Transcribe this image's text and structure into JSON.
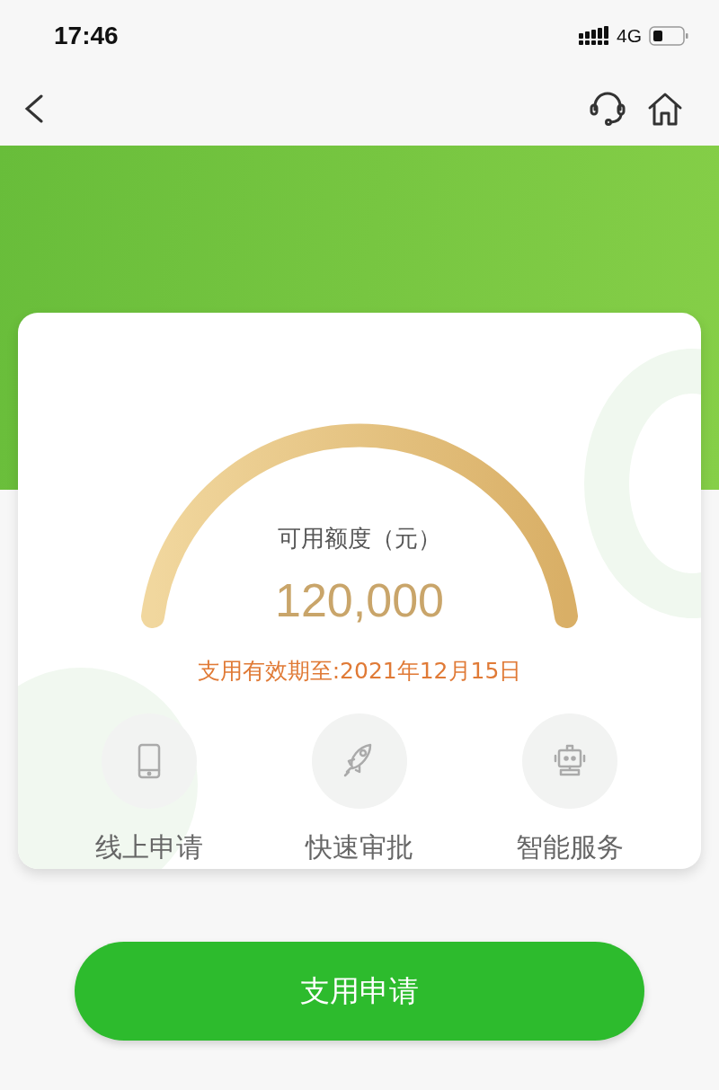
{
  "status_bar": {
    "time": "17:46",
    "network": "4G"
  },
  "quota": {
    "label": "可用额度（元）",
    "amount": "120,000",
    "expiry": "支用有效期至:2021年12月15日"
  },
  "features": [
    {
      "kind": "phone",
      "label": "线上申请"
    },
    {
      "kind": "rocket",
      "label": "快速审批"
    },
    {
      "kind": "robot",
      "label": "智能服务"
    }
  ],
  "primary_button": {
    "label": "支用申请"
  }
}
